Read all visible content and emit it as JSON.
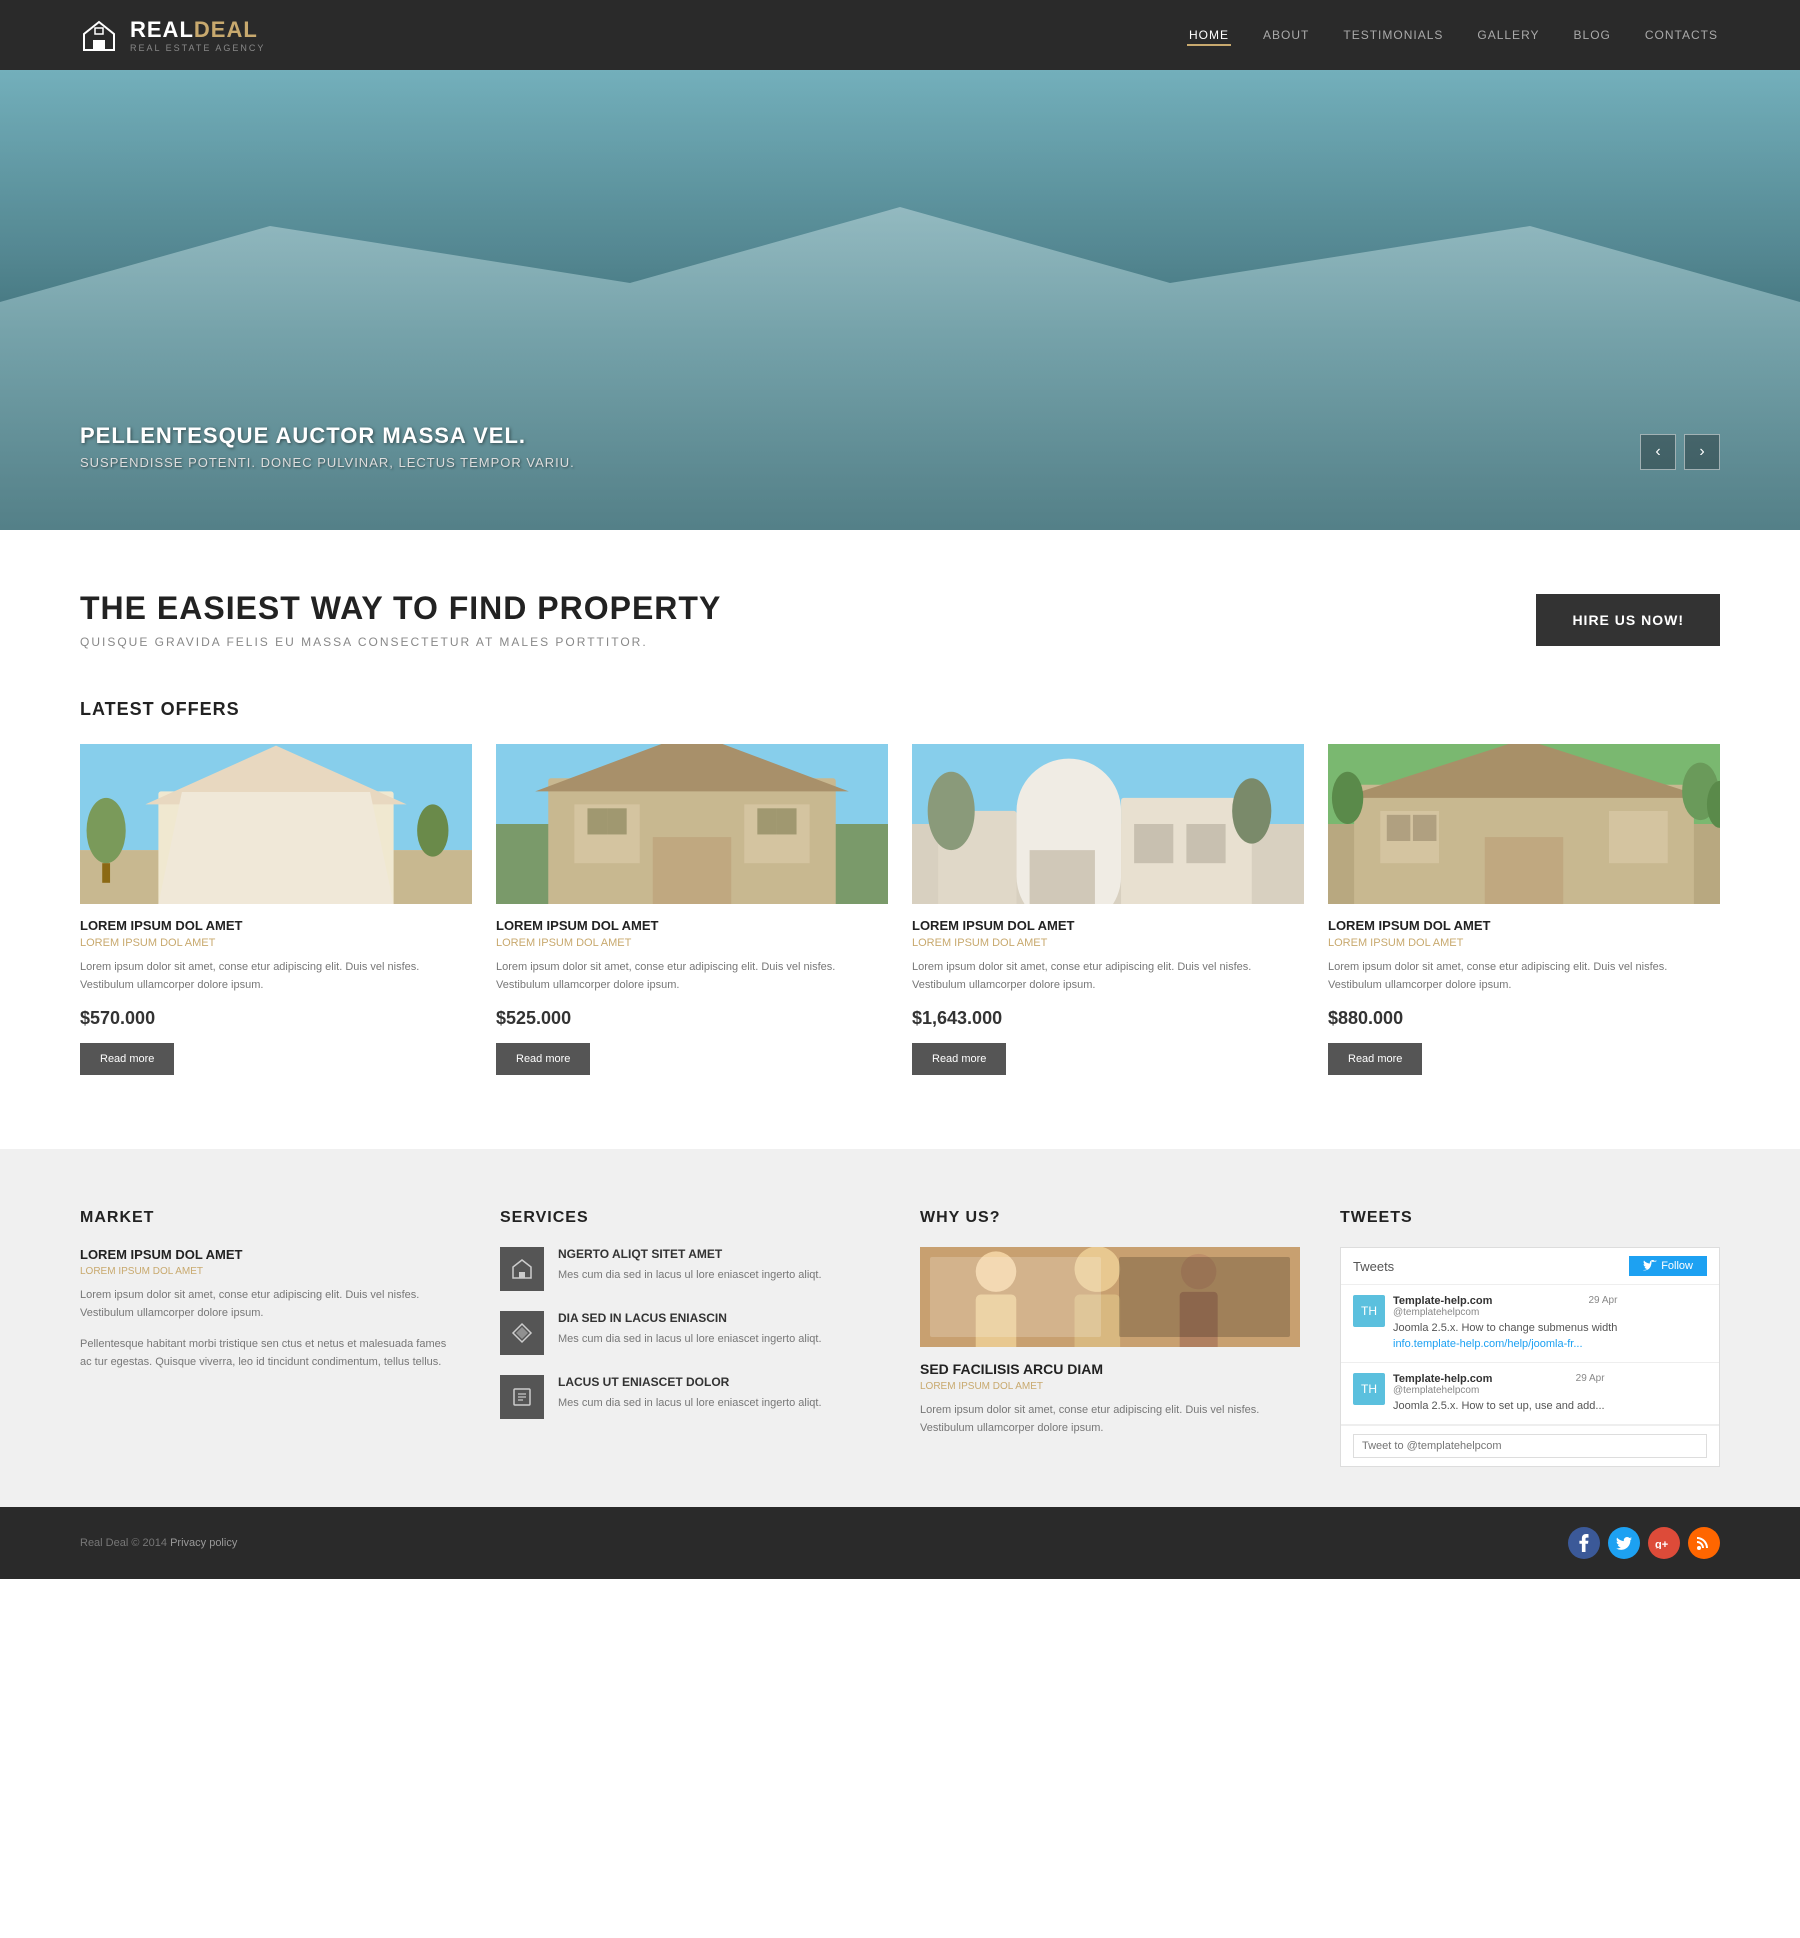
{
  "header": {
    "logo_text_real": "REAL",
    "logo_text_deal": "DEAL",
    "logo_sub": "REAL ESTATE AGENCY",
    "nav": [
      {
        "label": "HOME",
        "active": true
      },
      {
        "label": "ABOUT",
        "active": false
      },
      {
        "label": "TESTIMONIALS",
        "active": false
      },
      {
        "label": "GALLERY",
        "active": false
      },
      {
        "label": "BLOG",
        "active": false
      },
      {
        "label": "CONTACTS",
        "active": false
      }
    ]
  },
  "hero": {
    "title": "PELLENTESQUE AUCTOR MASSA VEL.",
    "subtitle": "SUSPENDISSE POTENTI. DONEC PULVINAR, LECTUS TEMPOR VARIU.",
    "prev_arrow": "‹",
    "next_arrow": "›"
  },
  "headline": {
    "title": "THE EASIEST WAY TO FIND PROPERTY",
    "subtitle": "QUISQUE GRAVIDA FELIS EU MASSA CONSECTETUR AT MALES PORTTITOR.",
    "hire_btn": "HIRE US NOW!"
  },
  "latest_offers": {
    "section_title": "LATEST OFFERS",
    "cards": [
      {
        "title": "LOREM IPSUM DOL AMET",
        "subtitle": "LOREM IPSUM DOL AMET",
        "desc": "Lorem ipsum dolor sit amet, conse etur adipiscing elit. Duis vel nisfes. Vestibulum ullamcorper dolore ipsum.",
        "price": "$570.000",
        "read_more": "Read more"
      },
      {
        "title": "LOREM IPSUM DOL AMET",
        "subtitle": "LOREM IPSUM DOL AMET",
        "desc": "Lorem ipsum dolor sit amet, conse etur adipiscing elit. Duis vel nisfes. Vestibulum ullamcorper dolore ipsum.",
        "price": "$525.000",
        "read_more": "Read more"
      },
      {
        "title": "LOREM IPSUM DOL AMET",
        "subtitle": "LOREM IPSUM DOL AMET",
        "desc": "Lorem ipsum dolor sit amet, conse etur adipiscing elit. Duis vel nisfes. Vestibulum ullamcorper dolore ipsum.",
        "price": "$1,643.000",
        "read_more": "Read more"
      },
      {
        "title": "LOREM IPSUM DOL AMET",
        "subtitle": "LOREM IPSUM DOL AMET",
        "desc": "Lorem ipsum dolor sit amet, conse etur adipiscing elit. Duis vel nisfes. Vestibulum ullamcorper dolore ipsum.",
        "price": "$880.000",
        "read_more": "Read more"
      }
    ]
  },
  "bottom": {
    "market": {
      "col_title": "MARKET",
      "item_title": "LOREM IPSUM DOL AMET",
      "item_subtitle": "LOREM IPSUM DOL AMET",
      "desc1": "Lorem ipsum dolor sit amet, conse etur adipiscing elit. Duis vel nisfes. Vestibulum ullamcorper dolore ipsum.",
      "desc2": "Pellentesque habitant morbi tristique sen ctus et netus et malesuada fames ac tur egestas. Quisque viverra, leo id tincidunt condimentum, tellus tellus."
    },
    "services": {
      "col_title": "SERVICES",
      "items": [
        {
          "icon": "🏠",
          "title": "NGERTO ALIQT SITET AMET",
          "desc": "Mes cum dia sed in lacus ul lore eniascet ingerto aliqt."
        },
        {
          "icon": "💎",
          "title": "DIA SED IN LACUS ENIASCIN",
          "desc": "Mes cum dia sed in lacus ul lore eniascet ingerto aliqt."
        },
        {
          "icon": "📋",
          "title": "LACUS UT ENIASCET DOLOR",
          "desc": "Mes cum dia sed in lacus ul lore eniascet ingerto aliqt."
        }
      ]
    },
    "whyus": {
      "col_title": "WHY US?",
      "item_title": "SED FACILISIS ARCU DIAM",
      "item_subtitle": "LOREM IPSUM DOL AMET",
      "desc": "Lorem ipsum dolor sit amet, conse etur adipiscing elit. Duis vel nisfes. Vestibulum ullamcorper dolore ipsum."
    },
    "tweets": {
      "col_title": "TWEETS",
      "widget_label": "Tweets",
      "follow_btn": "Follow",
      "items": [
        {
          "avatar": "TH",
          "author": "Template-help.com",
          "handle": "@templatehelpcom",
          "date": "29 Apr",
          "text": "Joomla 2.5.x. How to change submenus width",
          "link": "info.template-help.com/help/joomla-fr..."
        },
        {
          "avatar": "TH",
          "author": "Template-help.com",
          "handle": "@templatehelpcom",
          "date": "29 Apr",
          "text": "Joomla 2.5.x. How to set up, use and add...",
          "link": ""
        }
      ],
      "tweet_input_placeholder": "Tweet to @templatehelpcom"
    }
  },
  "footer": {
    "copy": "Real Deal",
    "copy_year": "© 2014",
    "privacy": "Privacy policy",
    "social": [
      {
        "name": "facebook",
        "label": "f"
      },
      {
        "name": "twitter",
        "label": "t"
      },
      {
        "name": "googleplus",
        "label": "g+"
      },
      {
        "name": "rss",
        "label": "rss"
      }
    ]
  }
}
